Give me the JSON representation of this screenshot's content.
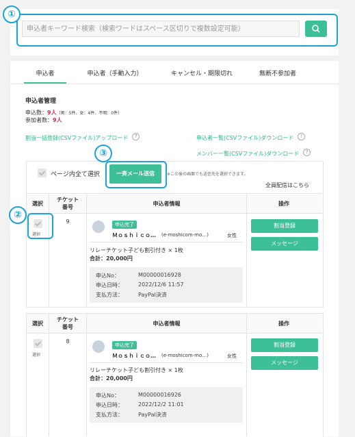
{
  "search": {
    "placeholder": "申込者キーワード検索（検索ワードはスペース区切りで複数設定可能）",
    "icon": "search-icon"
  },
  "callouts": {
    "n1": "①",
    "n2": "②",
    "n3": "③"
  },
  "tabs": [
    {
      "label": "申込者"
    },
    {
      "label": "申込者（手動入力）"
    },
    {
      "label": "キャンセル・期限切れ"
    },
    {
      "label": "無断不参加者"
    }
  ],
  "section": {
    "title": "申込者管理",
    "count_label": "申込数：",
    "count_value": "9人",
    "count_detail": "（男：5件、女：4件、不明：0件）",
    "attend_label": "参加者数：",
    "attend_value": "9人"
  },
  "links": {
    "bulk_upload": "割当一括登録(CSVファイル)アップロード",
    "applicants_csv": "申込者一覧(CSVファイル)ダウンロード",
    "members_csv": "メンバー一覧(CSVファイル)ダウンロード"
  },
  "bulk": {
    "select_all": "ページ内全て選択",
    "mail_button": "一斉メール送信",
    "note": "※この後の画面でも送信先を選択できます。",
    "all_send": "全員配信はこちら"
  },
  "table_headers": {
    "select": "選択",
    "ticket": "チケット\n番号",
    "info": "申込者情報",
    "ops": "操作"
  },
  "rows": [
    {
      "select_text": "選択",
      "ticket_no": "9",
      "status": "申込完了",
      "name": "Ｍｏｓｈｉｃｏ…",
      "email": "(e-moshicom-mo…)",
      "gender": "女性",
      "ticket_desc": "リレーチケット子ども割引付き × 1枚",
      "total": "合計：20,000円",
      "app_no_label": "申込No：",
      "app_no": "M00000016928",
      "date_label": "申込日時：",
      "date": "2022/12/6 11:57",
      "pay_label": "支払方法：",
      "pay": "PayPal決済",
      "btn_assign": "割当登録",
      "btn_message": "メッセージ"
    },
    {
      "select_text": "選択",
      "ticket_no": "8",
      "status": "申込完了",
      "name": "Ｍｏｓｈｉｃｏ…",
      "email": "(e-moshicom-mo…)",
      "gender": "女性",
      "ticket_desc": "リレーチケット子ども割引付き × 1枚",
      "total": "合計：20,000円",
      "app_no_label": "申込No：",
      "app_no": "M00000016926",
      "date_label": "申込日時：",
      "date": "2022/12/2 11:01",
      "pay_label": "支払方法：",
      "pay": "PayPal決済",
      "btn_assign": "割当登録",
      "btn_message": "メッセージ"
    }
  ],
  "colors": {
    "accent": "#3dbf97",
    "callout": "#1aa3d9",
    "red": "#d0304a"
  }
}
